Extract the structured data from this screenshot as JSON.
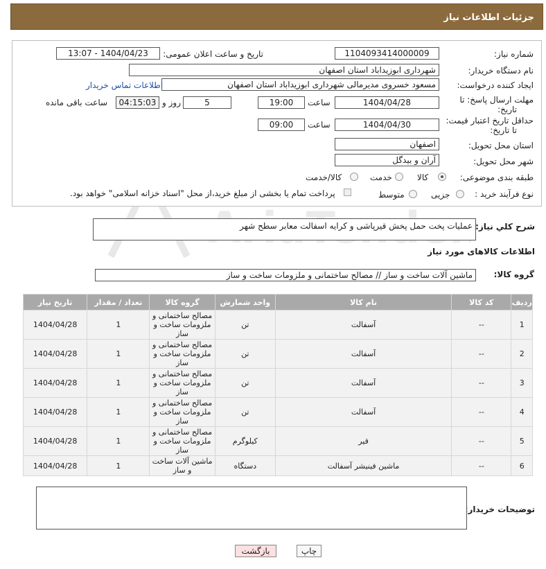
{
  "header": {
    "title": "جزئیات اطلاعات نیاز"
  },
  "form": {
    "need_number_label": "شماره نیاز:",
    "need_number": "1104093414000009",
    "announce_label": "تاریخ و ساعت اعلان عمومی:",
    "announce_value": "1404/04/23 - 13:07",
    "buyer_org_label": "نام دستگاه خریدار:",
    "buyer_org": "شهرداری ابوزیداباد استان اصفهان",
    "creator_label": "ایجاد کننده درخواست:",
    "creator": "مسعود خسروی مدیرمالی شهرداری ابوزیداباد استان اصفهان",
    "contact_link": "اطلاعات تماس خریدار",
    "deadline_label_1": "مهلت ارسال پاسخ: تا",
    "deadline_label_2": "تاریخ:",
    "deadline_date": "1404/04/28",
    "time_label": "ساعت",
    "deadline_time": "19:00",
    "days_value": "5",
    "days_label": "روز و",
    "remaining_value": "04:15:03",
    "remaining_label": "ساعت باقی مانده",
    "validity_label_1": "حداقل تاریخ اعتبار قیمت:",
    "validity_label_2": "تا تاریخ:",
    "validity_date": "1404/04/30",
    "validity_time": "09:00",
    "province_label": "استان محل تحویل:",
    "province": "اصفهان",
    "city_label": "شهر محل تحویل:",
    "city": "آران و بیدگل",
    "category_label": "طبقه بندی موضوعی:",
    "category_options": [
      "کالا",
      "خدمت",
      "کالا/خدمت"
    ],
    "category_selected": "کالا",
    "process_label": "نوع فرآیند خرید :",
    "process_options": [
      "جزیی",
      "متوسط"
    ],
    "payment_note": "پرداخت تمام یا بخشی از مبلغ خرید،از محل \"اسناد خزانه اسلامی\" خواهد بود."
  },
  "description": {
    "label": "شرح کلي نياز:",
    "value": "عملیات پخت حمل پخش قیرپاشی و کرایه اسفالت معابر سطح شهر"
  },
  "goods_section_title": "اطلاعات کالاهای مورد نیاز",
  "goods_group": {
    "label": "گروه کالا:",
    "value": "ماشین آلات ساخت و ساز // مصالح ساختمانی و ملزومات ساخت و ساز"
  },
  "table": {
    "headers": [
      "ردیف",
      "کد کالا",
      "نام کالا",
      "واحد شمارش",
      "گروه کالا",
      "تعداد / مقدار",
      "تاریخ نیاز"
    ],
    "rows": [
      [
        "1",
        "--",
        "آسفالت",
        "تن",
        "مصالح ساختمانی و ملزومات ساخت و ساز",
        "1",
        "1404/04/28"
      ],
      [
        "2",
        "--",
        "آسفالت",
        "تن",
        "مصالح ساختمانی و ملزومات ساخت و ساز",
        "1",
        "1404/04/28"
      ],
      [
        "3",
        "--",
        "آسفالت",
        "تن",
        "مصالح ساختمانی و ملزومات ساخت و ساز",
        "1",
        "1404/04/28"
      ],
      [
        "4",
        "--",
        "آسفالت",
        "تن",
        "مصالح ساختمانی و ملزومات ساخت و ساز",
        "1",
        "1404/04/28"
      ],
      [
        "5",
        "--",
        "قیر",
        "کیلوگرم",
        "مصالح ساختمانی و ملزومات ساخت و ساز",
        "1",
        "1404/04/28"
      ],
      [
        "6",
        "--",
        "ماشین فینیشر آسفالت",
        "دستگاه",
        "ماشین آلات ساخت و ساز",
        "1",
        "1404/04/28"
      ]
    ]
  },
  "buyer_notes": {
    "label": "توضیحات خریدار:",
    "value": ""
  },
  "buttons": {
    "print": "چاپ",
    "back": "بازگشت"
  },
  "watermark": "AriaTender.net",
  "colors": {
    "header_bg": "#8b6a3e",
    "table_header_bg": "#a9a9a9",
    "back_button_bg": "#fde0e0"
  }
}
